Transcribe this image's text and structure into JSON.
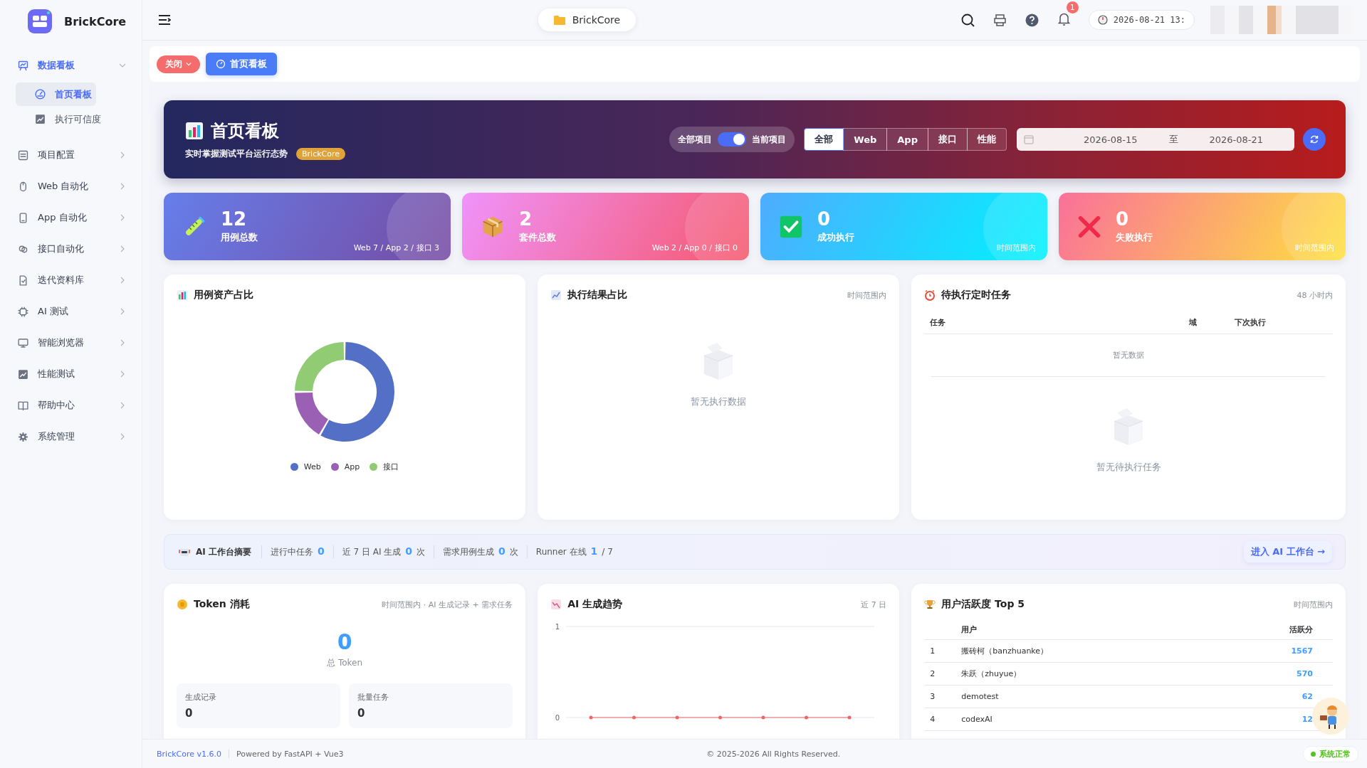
{
  "brand": {
    "name": "BrickCore"
  },
  "sidebar": {
    "items": [
      {
        "label": "数据看板",
        "kind": "dashboard",
        "expanded": true,
        "children": [
          {
            "label": "首页看板",
            "kind": "gauge",
            "selected": true
          },
          {
            "label": "执行可信度",
            "kind": "trend",
            "selected": false
          }
        ]
      },
      {
        "label": "项目配置",
        "kind": "config",
        "expanded": false
      },
      {
        "label": "Web 自动化",
        "kind": "mouse",
        "expanded": false
      },
      {
        "label": "App 自动化",
        "kind": "phone",
        "expanded": false
      },
      {
        "label": "接口自动化",
        "kind": "link",
        "expanded": false
      },
      {
        "label": "迭代资料库",
        "kind": "document",
        "expanded": false
      },
      {
        "label": "AI 测试",
        "kind": "chip",
        "expanded": false
      },
      {
        "label": "智能浏览器",
        "kind": "monitor",
        "expanded": false
      },
      {
        "label": "性能测试",
        "kind": "trend",
        "expanded": false
      },
      {
        "label": "帮助中心",
        "kind": "book",
        "expanded": false
      },
      {
        "label": "系统管理",
        "kind": "gear",
        "expanded": false
      }
    ]
  },
  "header": {
    "project": "BrickCore",
    "notification_count": "1",
    "clock": "2026-08-21 13:"
  },
  "tab_bar": {
    "close_button": "关闭",
    "tabs": [
      {
        "label": "首页看板",
        "selected": true
      }
    ]
  },
  "banner": {
    "title": "首页看板",
    "subtitle": "实时掌握测试平台运行态势",
    "badge": "BrickCore",
    "scope_toggle": {
      "left": "全部项目",
      "right": "当前项目",
      "on": true
    },
    "filters": [
      {
        "label": "全部",
        "selected": true
      },
      {
        "label": "Web",
        "selected": false
      },
      {
        "label": "App",
        "selected": false
      },
      {
        "label": "接口",
        "selected": false
      },
      {
        "label": "性能",
        "selected": false
      }
    ],
    "date_range": {
      "start": "2026-08-15",
      "separator": "至",
      "end": "2026-08-21"
    }
  },
  "stats": [
    {
      "kind": "cases",
      "value": "12",
      "label": "用例总数",
      "note": "Web 7 / App 2 / 接口 3"
    },
    {
      "kind": "suites",
      "value": "2",
      "label": "套件总数",
      "note": "Web 2 / App 0 / 接口 0"
    },
    {
      "kind": "success",
      "value": "0",
      "label": "成功执行",
      "note": "时间范围内"
    },
    {
      "kind": "failed",
      "value": "0",
      "label": "失败执行",
      "note": "时间范围内"
    }
  ],
  "asset_panel": {
    "title": "用例资产占比",
    "slices": [
      {
        "color": "#5470c6"
      },
      {
        "color": "#9a60b4"
      },
      {
        "color": "#91cc75"
      }
    ],
    "chart_data": {
      "type": "donut",
      "categories": [
        "Web",
        "App",
        "接口"
      ],
      "values": [
        58.3,
        16.7,
        25
      ]
    }
  },
  "result_panel": {
    "title": "执行结果占比",
    "note": "时间范围内",
    "empty_text": "暂无执行数据"
  },
  "schedule_panel": {
    "title": "待执行定时任务",
    "note": "48 小时内",
    "columns": [
      "任务",
      "域",
      "下次执行"
    ],
    "empty_row": "暂无数据",
    "empty_text": "暂无待执行任务"
  },
  "ai_summary": {
    "title": "AI 工作台摘要",
    "items": [
      {
        "label": "进行中任务",
        "value": "0"
      },
      {
        "label": "近 7 日 AI 生成",
        "value": "0",
        "unit": "次"
      },
      {
        "label": "需求用例生成",
        "value": "0",
        "unit": "次"
      },
      {
        "label": "Runner 在线",
        "value": "1",
        "unit": "/ 7"
      }
    ],
    "link": "进入 AI 工作台 →"
  },
  "token_panel": {
    "title": "Token 消耗",
    "note": "时间范围内 · AI 生成记录 + 需求任务",
    "total": "0",
    "total_label": "总 Token",
    "breakdown": [
      {
        "label": "生成记录",
        "value": "0"
      },
      {
        "label": "批量任务",
        "value": "0"
      }
    ]
  },
  "trend_panel": {
    "title": "AI 生成趋势",
    "note": "近 7 日",
    "chart_data": {
      "type": "line",
      "yticks": [
        0,
        1
      ],
      "ylim": [
        0,
        1
      ],
      "series": [
        {
          "color": "#ee6666",
          "values": [
            0,
            0,
            0,
            0,
            0,
            0,
            0
          ]
        }
      ]
    }
  },
  "activity_panel": {
    "title": "用户活跃度 Top 5",
    "note": "时间范围内",
    "columns": [
      "用户",
      "活跃分"
    ],
    "rows": [
      {
        "rank": "1",
        "user": "搬砖柯（banzhuanke）",
        "score": "1567"
      },
      {
        "rank": "2",
        "user": "朱跃（zhuyue）",
        "score": "570"
      },
      {
        "rank": "3",
        "user": "demotest",
        "score": "62"
      },
      {
        "rank": "4",
        "user": "codexAI",
        "score": "12"
      }
    ]
  },
  "footer": {
    "version": "BrickCore v1.6.0",
    "powered": "Powered by FastAPI + Vue3",
    "copyright": "© 2025-2026 All Rights Reserved.",
    "status": "系统正常"
  }
}
